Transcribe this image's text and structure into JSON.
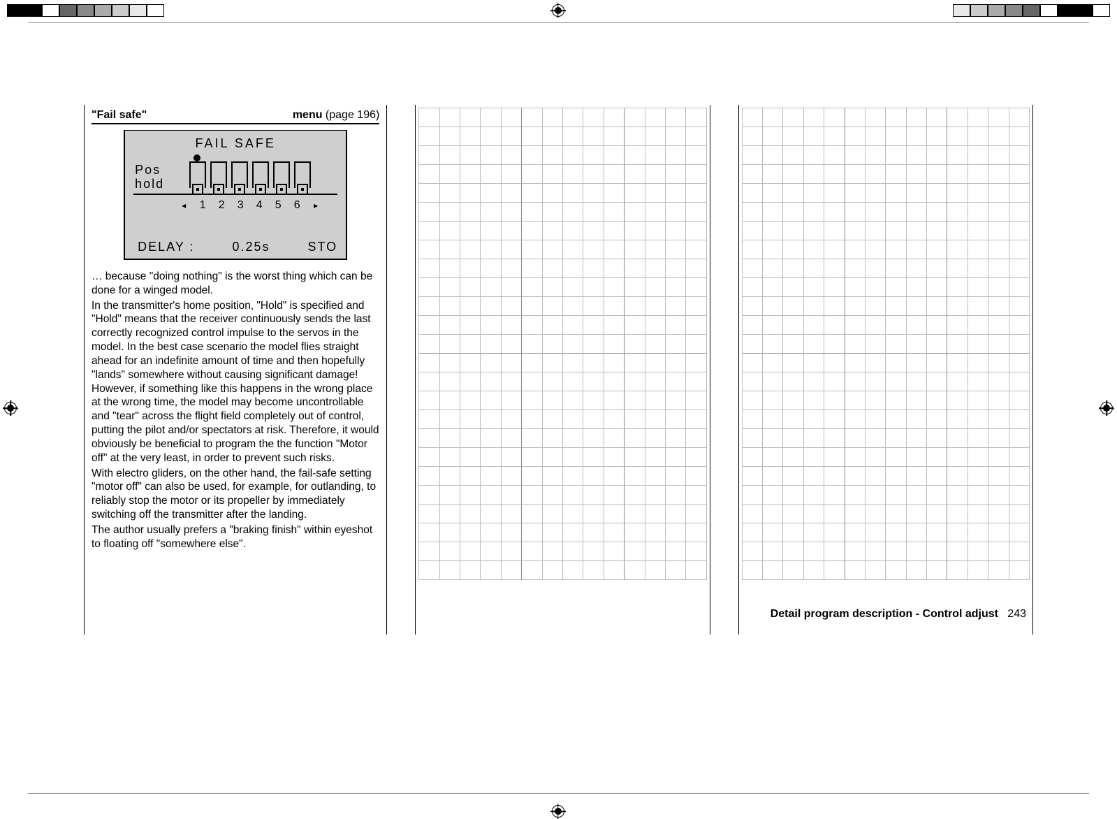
{
  "left_column": {
    "header_left": "\"Fail safe\"",
    "header_right_bold": "menu",
    "header_right_rest": " (page 196)",
    "lcd": {
      "title": "FAIL  SAFE",
      "row1": "Pos",
      "row2": "hold",
      "channels": [
        "1",
        "2",
        "3",
        "4",
        "5",
        "6"
      ],
      "left_arrow": "◂",
      "right_arrow": "▸",
      "delay_label": "DELAY :",
      "delay_value": "0.25s",
      "sto": "STO"
    },
    "para1": "… because \"doing nothing\" is the worst thing which can be done for a winged model.",
    "para2": "In the transmitter's home position, \"Hold\" is specified and \"Hold\" means that the receiver continuously sends the last correctly recognized control impulse to the servos in the model. In the best case scenario the model flies straight ahead for an indefinite amount of time and then hopefully \"lands\" somewhere without causing significant damage! However, if something like this happens in the wrong place at the wrong time, the model may become uncontrollable and \"tear\" across the flight field completely out of control, putting the pilot and/or spectators at risk. Therefore, it would obviously be beneficial to program the the function \"Motor off\" at the very least, in order to prevent such risks.",
    "para3": "With electro gliders, on the other hand, the fail-safe setting \"motor off\" can also be used, for example, for outlanding, to reliably stop the motor or its propeller by immediately switching off the transmitter after the landing.",
    "para4": "The author usually prefers a \"braking finish\" within eyeshot to floating off \"somewhere else\"."
  },
  "footer": {
    "label": "Detail program description - Control adjust",
    "page": "243"
  },
  "swatch_colors": {
    "left": [
      "#000",
      "#000",
      "#fff",
      "#666",
      "#888",
      "#aaa",
      "#ccc",
      "#e8e8e8",
      "#fff"
    ],
    "right": [
      "#e8e8e8",
      "#ccc",
      "#aaa",
      "#888",
      "#666",
      "#fff",
      "#000",
      "#000",
      "#fff"
    ]
  }
}
